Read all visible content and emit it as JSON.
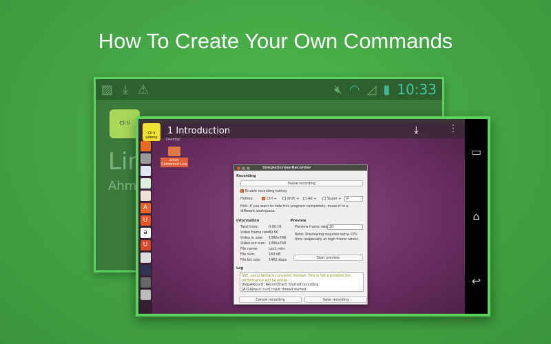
{
  "title": "How To Create Your Own Commands",
  "back_screen": {
    "status_icons": [
      "image-icon",
      "download-icon",
      "warning-icon",
      "mute-icon",
      "wifi-icon",
      "signal-icon",
      "battery-icon"
    ],
    "clock": "10:33",
    "logo_text": "Cli li",
    "big_text": "Lin",
    "sub_text": "Ahm"
  },
  "front_screen": {
    "app_title": "1  Introduction",
    "logo_text": "Cli li udemy",
    "desktop_label": "Desktop",
    "folder_label": "Linux Command Line",
    "dock_icons": [
      "firefox",
      "files",
      "writer",
      "calc",
      "impress",
      "software-center",
      "ubuntu-one",
      "amazon",
      "ubuntu-one-music",
      "settings",
      "workspaces",
      "printer",
      "trash"
    ],
    "nav": {
      "recent": "▭",
      "home": "⌂",
      "back": "↩"
    },
    "dialog": {
      "title": "SimpleScreenRecorder",
      "recording_heading": "Recording",
      "pause_button": "Pause recording",
      "enable_hotkey": "Enable recording hotkey",
      "enable_hotkey_checked": true,
      "hotkey_label": "Hotkey:",
      "ctrl": "Ctrl +",
      "ctrl_checked": true,
      "shift": "Shift +",
      "alt": "Alt +",
      "super": "Super +",
      "key": "R",
      "hint": "Hint: If you want to hide this program completely, move it to a different workspace.",
      "information_heading": "Information",
      "info": [
        {
          "label": "Total time:",
          "value": "0:00:01"
        },
        {
          "label": "Video frame rate:",
          "value": "30.00"
        },
        {
          "label": "Video in size:",
          "value": "1366x768"
        },
        {
          "label": "Video out size:",
          "value": "1366x768"
        },
        {
          "label": "File name:",
          "value": "Lec1.mkv"
        },
        {
          "label": "File size:",
          "value": "183 kB"
        },
        {
          "label": "File bit rate:",
          "value": "1462 kbps"
        }
      ],
      "preview_heading": "Preview",
      "preview_rate_label": "Preview frame rate:",
      "preview_rate": "10",
      "preview_note": "Note: Previewing requires extra CPU time (especially at high frame rates).",
      "start_preview": "Start preview",
      "log_heading": "Log",
      "log_lines": [
        "SSE, using fallback converter instead. This is not a problem but performance will be worse.",
        "[PageRecord::RecordStart] Started recording.",
        "[ALSAInput::run] Input thread started."
      ],
      "cancel_button": "Cancel recording",
      "save_button": "Save recording"
    }
  }
}
